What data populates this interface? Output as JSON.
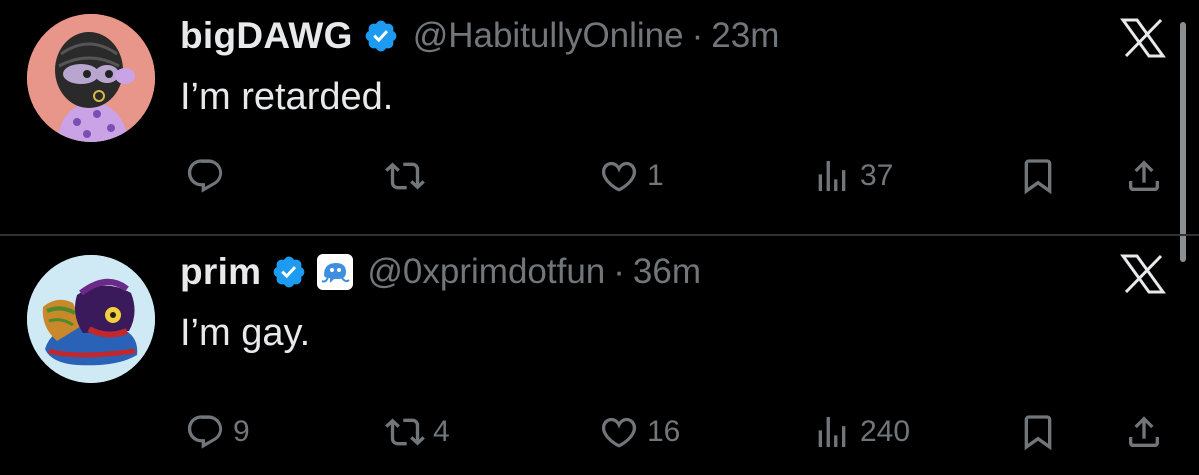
{
  "tweets": [
    {
      "display_name": "bigDAWG",
      "handle": "@HabitullyOnline",
      "separator": "·",
      "time": "23m",
      "text": "I’m retarded.",
      "counts": {
        "reply": "",
        "retweet": "",
        "like": "1",
        "views": "37"
      }
    },
    {
      "display_name": "prim",
      "handle": "@0xprimdotfun",
      "separator": "·",
      "time": "36m",
      "text": "I’m gay.",
      "counts": {
        "reply": "9",
        "retweet": "4",
        "like": "16",
        "views": "240"
      }
    }
  ],
  "colors": {
    "background": "#000000",
    "text": "#e7e9ea",
    "muted": "#71767b",
    "verified": "#1d9bf0",
    "divider": "#2f3336"
  },
  "icons": [
    "x-logo-icon",
    "verified-badge-icon",
    "reply-icon",
    "retweet-icon",
    "like-icon",
    "views-icon",
    "bookmark-icon",
    "share-icon"
  ]
}
